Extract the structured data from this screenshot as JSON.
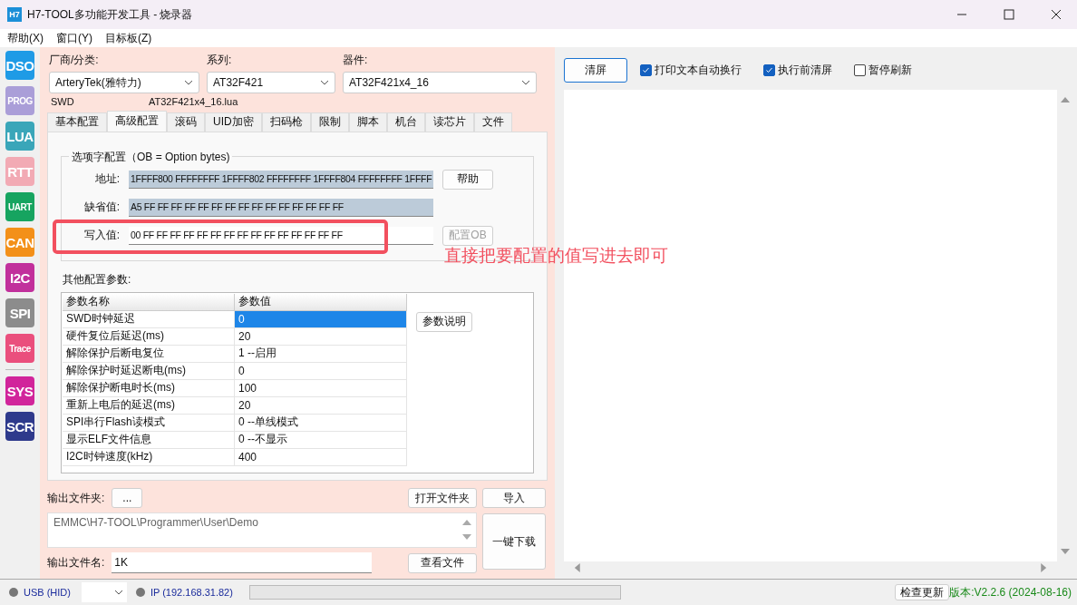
{
  "window": {
    "logo": "H7",
    "title": "H7-TOOL多功能开发工具 - 烧录器"
  },
  "menu": [
    "帮助(X)",
    "窗口(Y)",
    "目标板(Z)"
  ],
  "nav": [
    [
      {
        "label": "DSO",
        "color": "#1e9be6"
      },
      {
        "label": "PROG",
        "color": "#aa9ed8"
      },
      {
        "label": "LUA",
        "color": "#3aa6b9"
      },
      {
        "label": "RTT",
        "color": "#f2aab4"
      },
      {
        "label": "UART",
        "color": "#16a460"
      },
      {
        "label": "CAN",
        "color": "#f39019"
      },
      {
        "label": "I2C",
        "color": "#c1309c"
      },
      {
        "label": "SPI",
        "color": "#8c8c8c"
      },
      {
        "label": "Trace",
        "color": "#ea4f7d"
      }
    ],
    [
      {
        "label": "SYS",
        "color": "#d1259b"
      },
      {
        "label": "SCR",
        "color": "#2e3a8c"
      }
    ]
  ],
  "selectors": [
    {
      "label": "厂商/分类:",
      "value": "ArteryTek(雅特力)"
    },
    {
      "label": "系列:",
      "value": "AT32F421"
    },
    {
      "label": "器件:",
      "value": "AT32F421x4_16"
    }
  ],
  "interface": "SWD",
  "script_file": "AT32F421x4_16.lua",
  "tabs": [
    {
      "label": "基本配置",
      "selected": false
    },
    {
      "label": "高级配置",
      "selected": true
    },
    {
      "label": "滚码",
      "selected": false
    },
    {
      "label": "UID加密",
      "selected": false
    },
    {
      "label": "扫码枪",
      "selected": false
    },
    {
      "label": "限制",
      "selected": false
    },
    {
      "label": "脚本",
      "selected": false
    },
    {
      "label": "机台",
      "selected": false
    },
    {
      "label": "读芯片",
      "selected": false
    },
    {
      "label": "文件",
      "selected": false
    }
  ],
  "option_bytes": {
    "title": "选项字配置（OB = Option bytes)",
    "fields": [
      {
        "label": "地址:",
        "value": "1FFFF800 FFFFFFFF  1FFFF802 FFFFFFFF  1FFFF804 FFFFFFFF  1FFFF",
        "kind": "readonly"
      },
      {
        "label": "缺省值:",
        "value": "A5 FF FF FF FF FF FF FF FF FF FF FF FF FF FF FF",
        "kind": "readonly"
      },
      {
        "label": "写入值:",
        "value": "00 FF FF FF FF FF FF FF FF FF FF FF FF FF FF FF",
        "kind": "editable"
      }
    ],
    "help_button": "帮助",
    "config_button": {
      "label": "配置OB",
      "disabled": true
    }
  },
  "annotation": {
    "text": "直接把要配置的值写进去即可"
  },
  "params": {
    "title": "其他配置参数:",
    "columns": [
      "参数名称",
      "参数值"
    ],
    "rows": [
      {
        "name": "SWD时钟延迟",
        "value": "0",
        "selected": true
      },
      {
        "name": "硬件复位后延迟(ms)",
        "value": "20",
        "selected": false
      },
      {
        "name": "解除保护后断电复位",
        "value": "1 --启用",
        "selected": false
      },
      {
        "name": "解除保护时延迟断电(ms)",
        "value": "0",
        "selected": false
      },
      {
        "name": "解除保护断电时长(ms)",
        "value": "100",
        "selected": false
      },
      {
        "name": "重新上电后的延迟(ms)",
        "value": "20",
        "selected": false
      },
      {
        "name": "SPI串行Flash读模式",
        "value": "0 --单线模式",
        "selected": false
      },
      {
        "name": "显示ELF文件信息",
        "value": "0 --不显示",
        "selected": false
      },
      {
        "name": "I2C时钟速度(kHz)",
        "value": "400",
        "selected": false
      }
    ],
    "help_button": "参数说明"
  },
  "output": {
    "folder_label": "输出文件夹:",
    "browse_button": "...",
    "open_folder_button": "打开文件夹",
    "import_button": "导入",
    "path": "EMMC\\H7-TOOL\\Programmer\\User\\Demo",
    "download_button": "一键下载",
    "name_label": "输出文件名:",
    "name_value": "1K",
    "view_button": "查看文件"
  },
  "console": {
    "clear_button": "清屏",
    "options": [
      {
        "label": "打印文本自动换行",
        "checked": true
      },
      {
        "label": "执行前清屏",
        "checked": true
      },
      {
        "label": "暂停刷新",
        "checked": false
      }
    ]
  },
  "status_bar": {
    "progress": {
      "level": 0
    },
    "usb": "USB (HID)",
    "ip": "IP (192.168.31.82)",
    "update_button": "检查更新",
    "version": "版本:V2.2.6 (2024-08-16)"
  }
}
